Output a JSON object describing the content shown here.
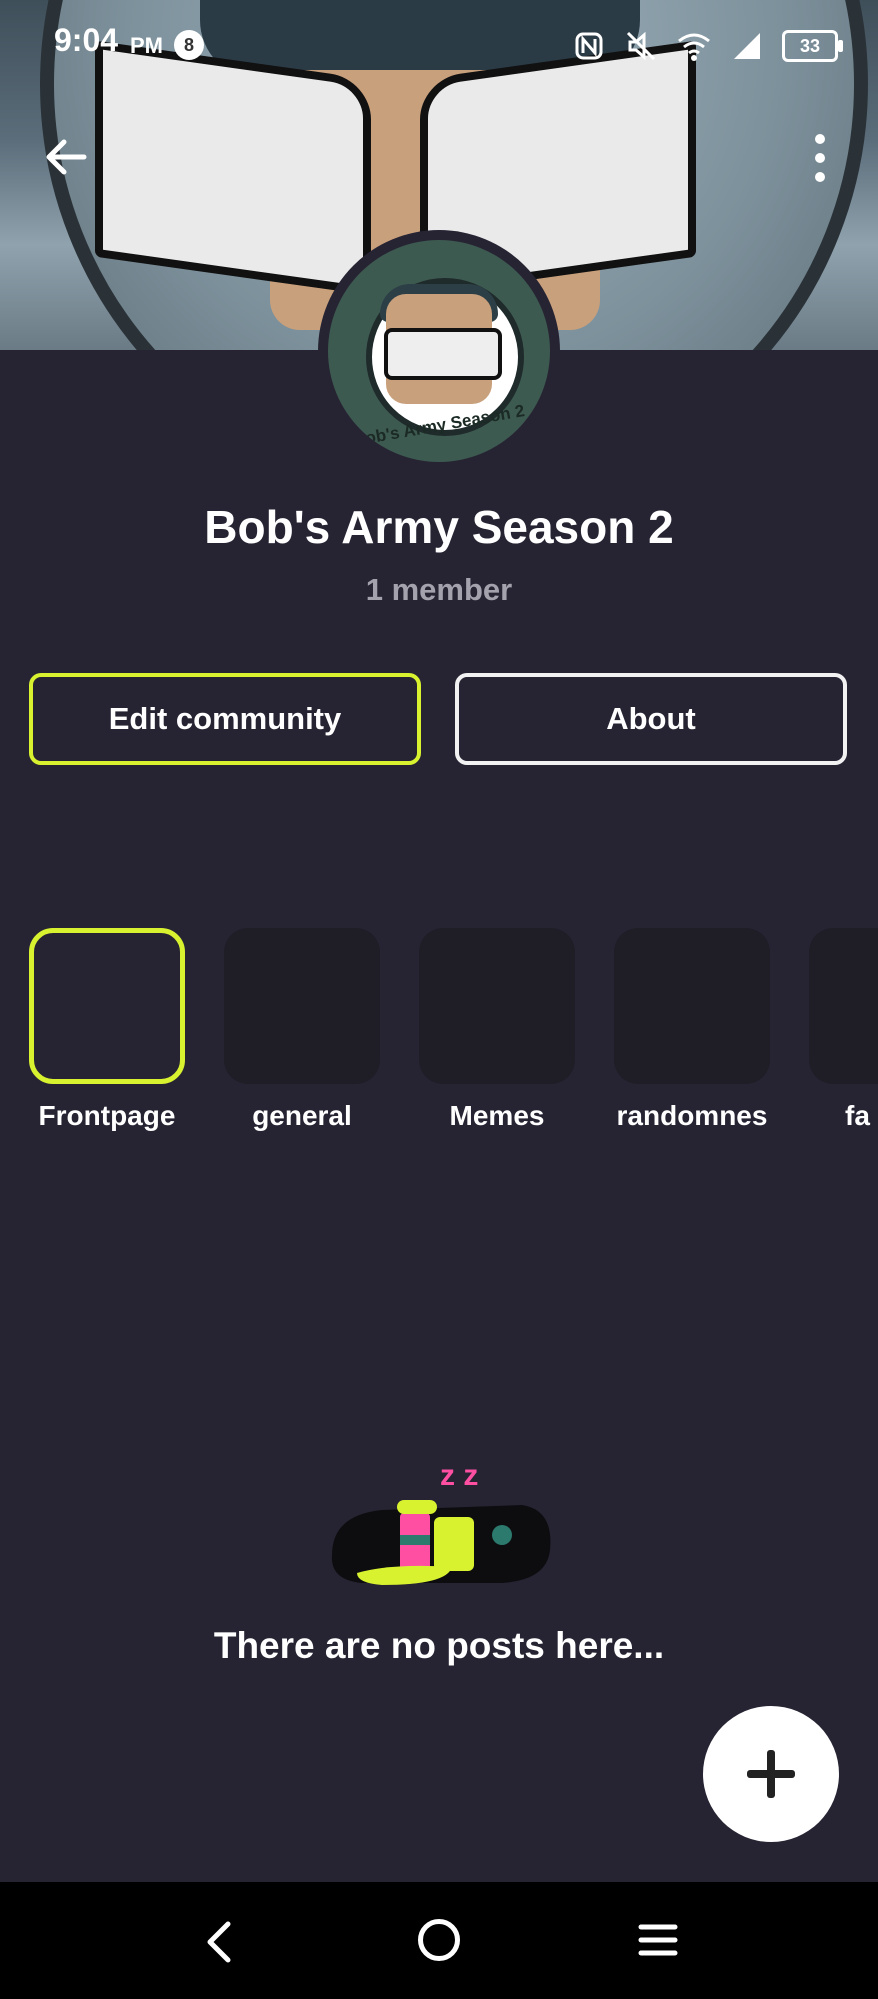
{
  "status_bar": {
    "time": "9:04",
    "ampm": "PM",
    "notification_count": "8",
    "battery": "33"
  },
  "community": {
    "name": "Bob's Army Season 2",
    "members": "1 member",
    "avatar_text": "Bob's Army Season 2"
  },
  "actions": {
    "edit_label": "Edit community",
    "about_label": "About"
  },
  "channels": [
    {
      "label": "Frontpage",
      "active": true
    },
    {
      "label": "general",
      "active": false
    },
    {
      "label": "Memes",
      "active": false
    },
    {
      "label": "randomnes",
      "active": false
    },
    {
      "label": "fa",
      "active": false
    }
  ],
  "empty_state": {
    "message": "There are no posts here...",
    "sleep_text": "z z"
  },
  "colors": {
    "background": "#262433",
    "accent": "#d8f230",
    "tile": "#1f1d26"
  }
}
